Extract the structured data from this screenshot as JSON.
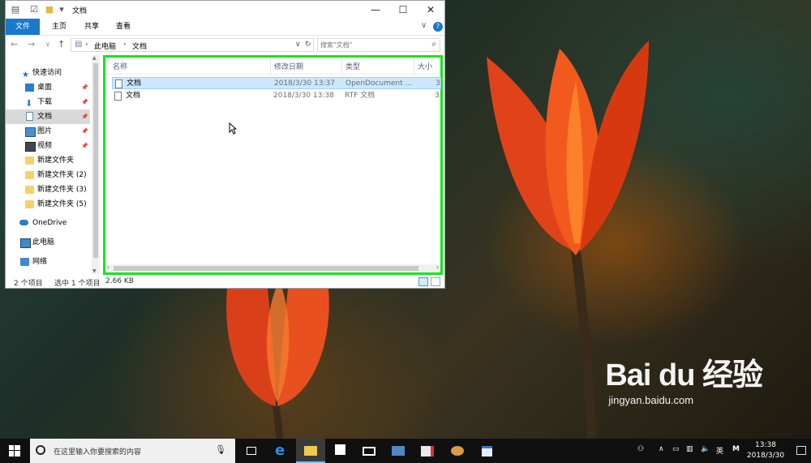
{
  "window": {
    "title": "文档",
    "controls": {
      "minimize": "—",
      "maximize": "☐",
      "close": "✕"
    },
    "ribbon_tabs": [
      "文件",
      "主页",
      "共享",
      "查看"
    ],
    "ribbon_chevron": "∨",
    "help": "?"
  },
  "navbar": {
    "back": "←",
    "forward": "→",
    "recent": "∨",
    "up": "↑",
    "path_sep": "›",
    "path": [
      "此电脑",
      "文档"
    ],
    "dropdown": "∨",
    "refresh": "↻",
    "search_placeholder": "搜索\"文档\"",
    "search_icon": "⌕"
  },
  "nav_pane": {
    "items": [
      {
        "label": "快速访问",
        "icon": "star-icon"
      },
      {
        "label": "桌面",
        "icon": "desktop-icon",
        "pinned": true
      },
      {
        "label": "下载",
        "icon": "download-icon",
        "pinned": true
      },
      {
        "label": "文档",
        "icon": "document-icon",
        "pinned": true,
        "selected": true
      },
      {
        "label": "图片",
        "icon": "picture-icon",
        "pinned": true
      },
      {
        "label": "视频",
        "icon": "video-icon",
        "pinned": true
      },
      {
        "label": "新建文件夹",
        "icon": "folder-icon"
      },
      {
        "label": "新建文件夹 (2)",
        "icon": "folder-icon"
      },
      {
        "label": "新建文件夹 (3)",
        "icon": "folder-icon"
      },
      {
        "label": "新建文件夹 (5)",
        "icon": "folder-icon"
      },
      {
        "label": "OneDrive",
        "icon": "cloud-icon"
      },
      {
        "label": "此电脑",
        "icon": "computer-icon"
      },
      {
        "label": "网络",
        "icon": "network-icon"
      }
    ],
    "pin_glyph": "📌"
  },
  "columns": [
    "名称",
    "修改日期",
    "类型",
    "大小"
  ],
  "files": [
    {
      "name": "文档",
      "modified": "2018/3/30 13:37",
      "type": "OpenDocument ...",
      "size": "3",
      "selected": true
    },
    {
      "name": "文档",
      "modified": "2018/3/30 13:38",
      "type": "RTF 文档",
      "size": "3",
      "selected": false
    }
  ],
  "status": {
    "item_count": "2 个项目",
    "selection": "选中 1 个项目",
    "size": "2.66 KB"
  },
  "taskbar": {
    "search_placeholder": "在这里输入你要搜索的内容",
    "tray_ime": "英",
    "tray_m": "M",
    "time": "13:38",
    "date": "2018/3/30",
    "tray_chevron": "∧"
  },
  "watermark": {
    "logo": "Bai du 经验",
    "url": "jingyan.baidu.com"
  },
  "colors": {
    "accent": "#1979ca",
    "highlight_border": "#17e61c",
    "selection": "#cce8ff"
  }
}
